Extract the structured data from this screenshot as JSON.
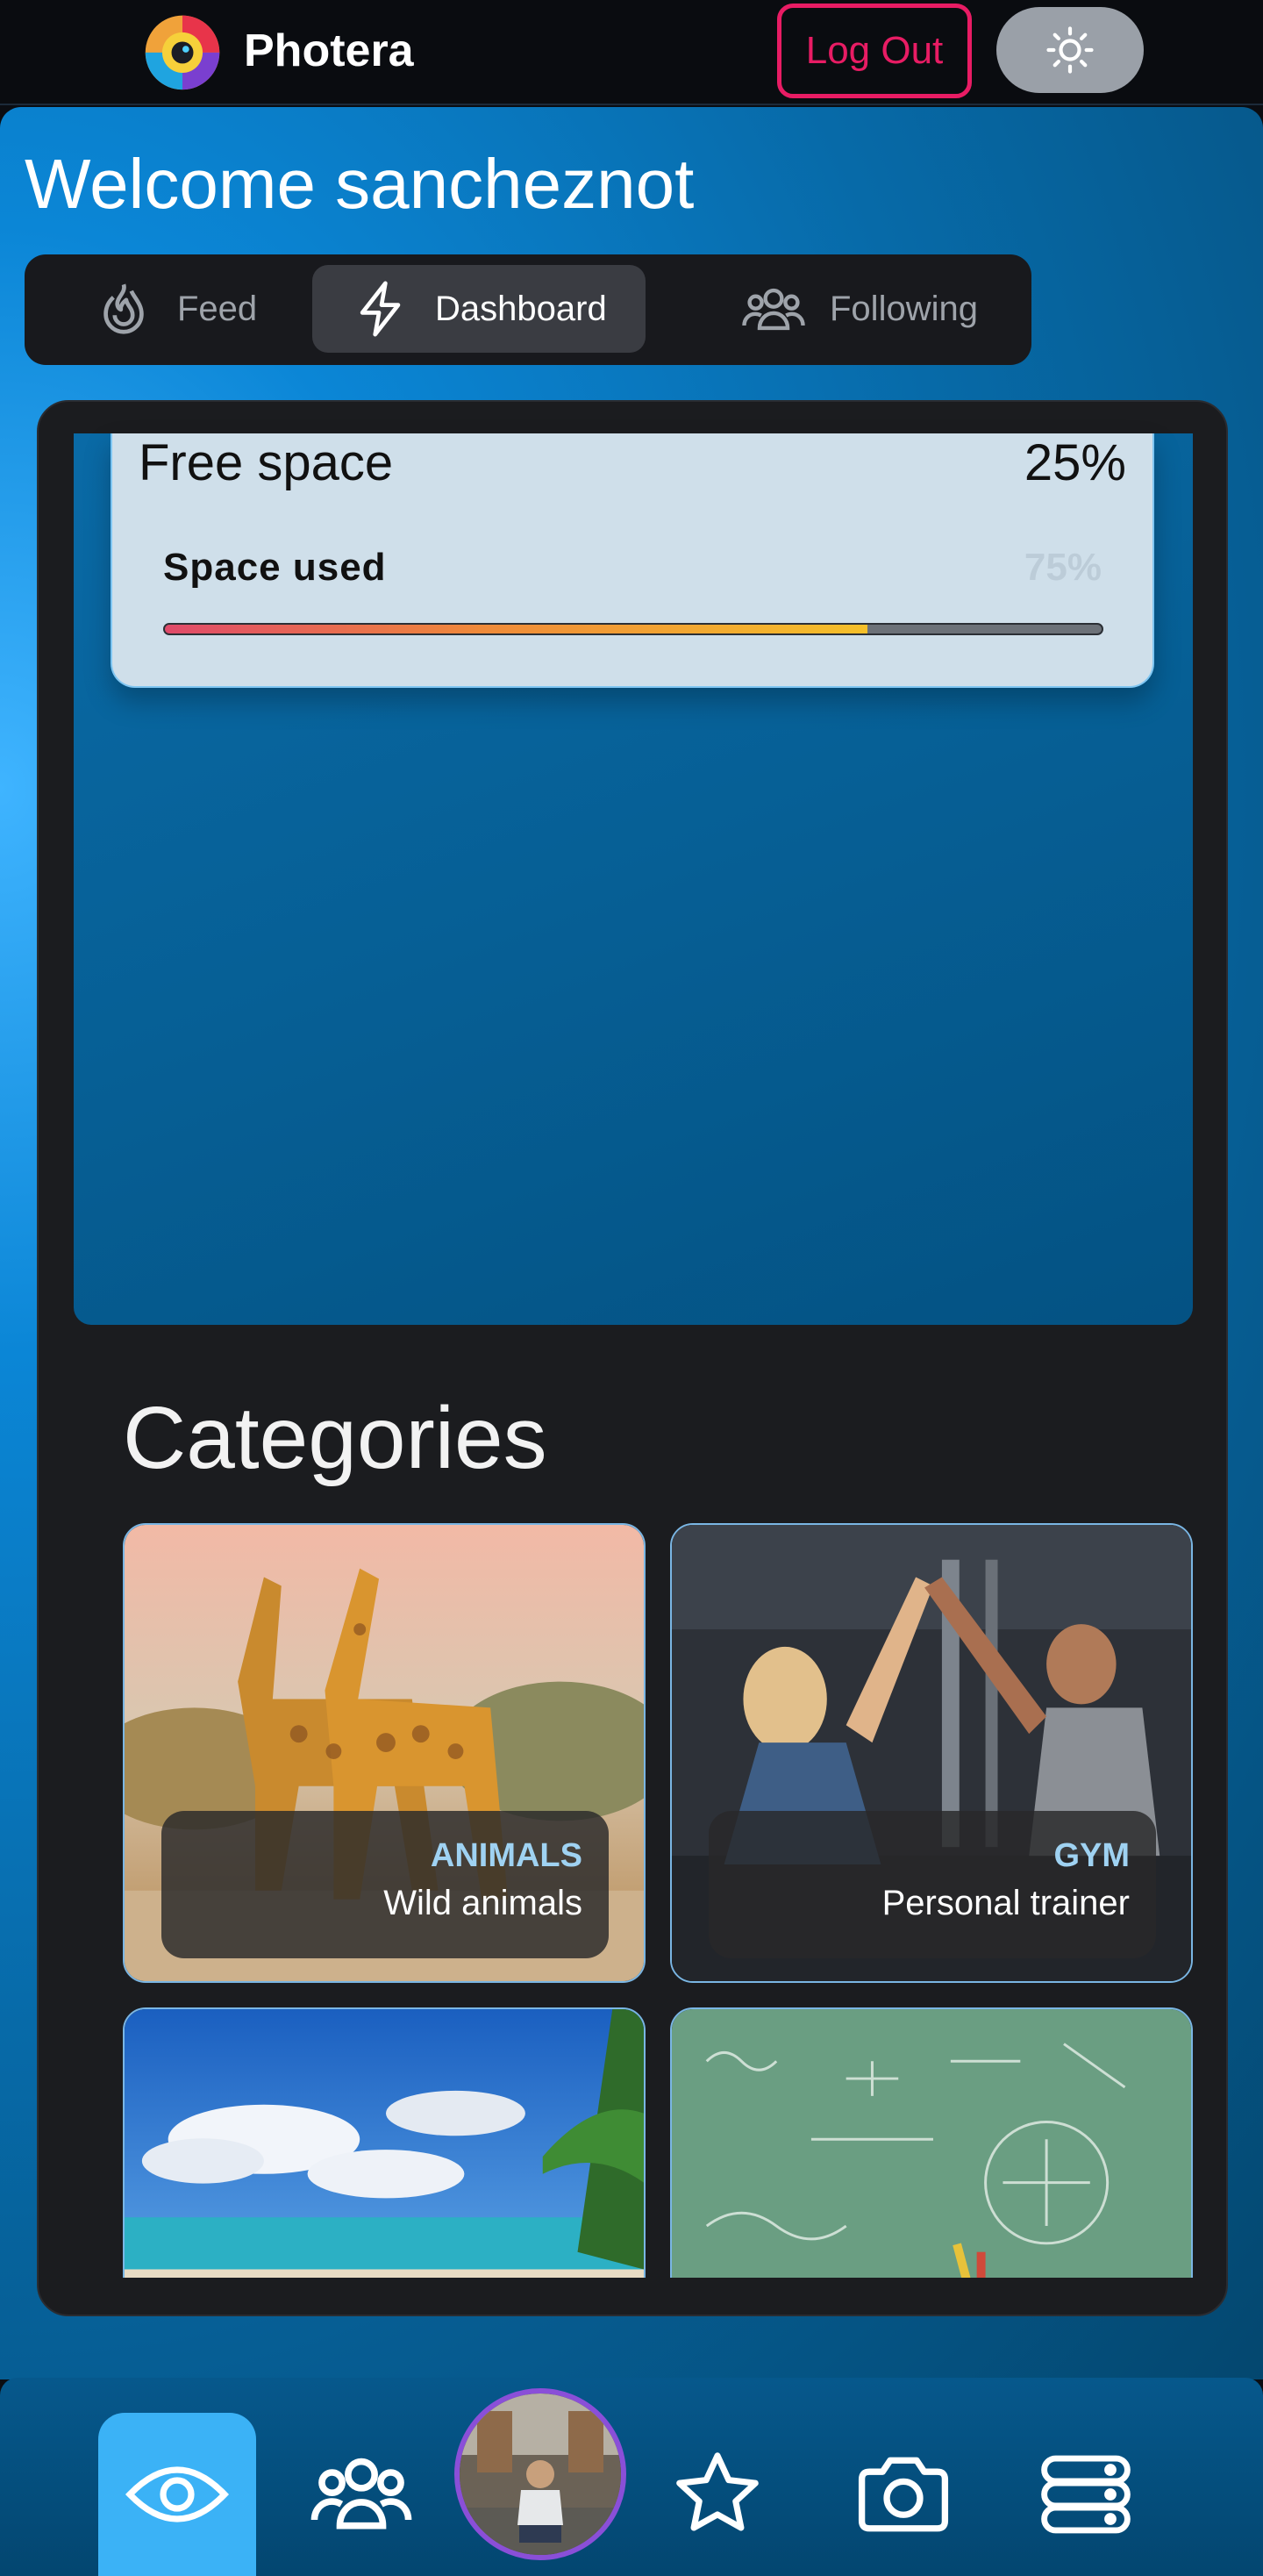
{
  "header": {
    "app_name": "Photera",
    "logout_label": "Log Out",
    "theme_icon": "sun-icon"
  },
  "welcome": "Welcome sancheznot",
  "tabs": [
    {
      "label": "Feed",
      "icon": "flame-icon",
      "active": false
    },
    {
      "label": "Dashboard",
      "icon": "lightning-icon",
      "active": true
    },
    {
      "label": "Following",
      "icon": "people-icon",
      "active": false
    }
  ],
  "storage": {
    "free_label": "Free space",
    "free_value": "25%",
    "used_label": "Space used",
    "used_value": "75%",
    "used_fraction": 0.75
  },
  "categories": {
    "title": "Categories",
    "items": [
      {
        "title": "ANIMALS",
        "subtitle": "Wild animals"
      },
      {
        "title": "GYM",
        "subtitle": "Personal trainer"
      },
      {
        "title": "",
        "subtitle": ""
      },
      {
        "title": "",
        "subtitle": ""
      }
    ]
  },
  "bottom_nav": [
    {
      "icon": "eye-icon",
      "active": true
    },
    {
      "icon": "group-icon",
      "active": false
    },
    {
      "icon": "avatar",
      "active": false
    },
    {
      "icon": "star-icon",
      "active": false
    },
    {
      "icon": "camera-icon",
      "active": false
    },
    {
      "icon": "server-icon",
      "active": false
    }
  ],
  "colors": {
    "accent_logout": "#e81c64",
    "nav_active": "#3bb2f6",
    "avatar_ring": "#8a4fd8",
    "category_title": "#9fd2f2"
  }
}
